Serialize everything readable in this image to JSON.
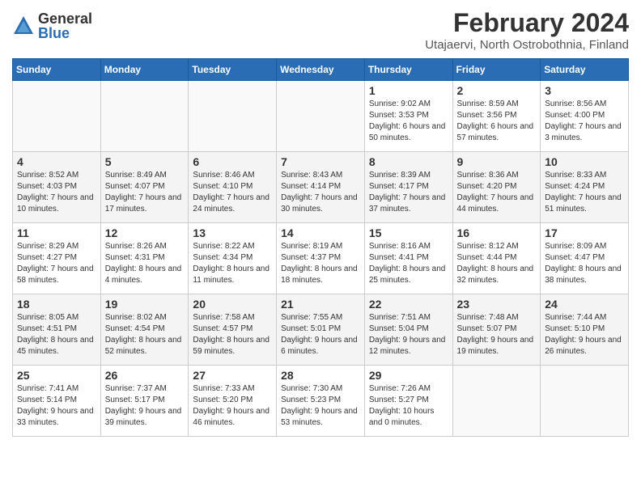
{
  "logo": {
    "general": "General",
    "blue": "Blue"
  },
  "title": "February 2024",
  "subtitle": "Utajaervi, North Ostrobothnia, Finland",
  "days_of_week": [
    "Sunday",
    "Monday",
    "Tuesday",
    "Wednesday",
    "Thursday",
    "Friday",
    "Saturday"
  ],
  "weeks": [
    [
      {
        "day": "",
        "info": ""
      },
      {
        "day": "",
        "info": ""
      },
      {
        "day": "",
        "info": ""
      },
      {
        "day": "",
        "info": ""
      },
      {
        "day": "1",
        "info": "Sunrise: 9:02 AM\nSunset: 3:53 PM\nDaylight: 6 hours\nand 50 minutes."
      },
      {
        "day": "2",
        "info": "Sunrise: 8:59 AM\nSunset: 3:56 PM\nDaylight: 6 hours\nand 57 minutes."
      },
      {
        "day": "3",
        "info": "Sunrise: 8:56 AM\nSunset: 4:00 PM\nDaylight: 7 hours\nand 3 minutes."
      }
    ],
    [
      {
        "day": "4",
        "info": "Sunrise: 8:52 AM\nSunset: 4:03 PM\nDaylight: 7 hours\nand 10 minutes."
      },
      {
        "day": "5",
        "info": "Sunrise: 8:49 AM\nSunset: 4:07 PM\nDaylight: 7 hours\nand 17 minutes."
      },
      {
        "day": "6",
        "info": "Sunrise: 8:46 AM\nSunset: 4:10 PM\nDaylight: 7 hours\nand 24 minutes."
      },
      {
        "day": "7",
        "info": "Sunrise: 8:43 AM\nSunset: 4:14 PM\nDaylight: 7 hours\nand 30 minutes."
      },
      {
        "day": "8",
        "info": "Sunrise: 8:39 AM\nSunset: 4:17 PM\nDaylight: 7 hours\nand 37 minutes."
      },
      {
        "day": "9",
        "info": "Sunrise: 8:36 AM\nSunset: 4:20 PM\nDaylight: 7 hours\nand 44 minutes."
      },
      {
        "day": "10",
        "info": "Sunrise: 8:33 AM\nSunset: 4:24 PM\nDaylight: 7 hours\nand 51 minutes."
      }
    ],
    [
      {
        "day": "11",
        "info": "Sunrise: 8:29 AM\nSunset: 4:27 PM\nDaylight: 7 hours\nand 58 minutes."
      },
      {
        "day": "12",
        "info": "Sunrise: 8:26 AM\nSunset: 4:31 PM\nDaylight: 8 hours\nand 4 minutes."
      },
      {
        "day": "13",
        "info": "Sunrise: 8:22 AM\nSunset: 4:34 PM\nDaylight: 8 hours\nand 11 minutes."
      },
      {
        "day": "14",
        "info": "Sunrise: 8:19 AM\nSunset: 4:37 PM\nDaylight: 8 hours\nand 18 minutes."
      },
      {
        "day": "15",
        "info": "Sunrise: 8:16 AM\nSunset: 4:41 PM\nDaylight: 8 hours\nand 25 minutes."
      },
      {
        "day": "16",
        "info": "Sunrise: 8:12 AM\nSunset: 4:44 PM\nDaylight: 8 hours\nand 32 minutes."
      },
      {
        "day": "17",
        "info": "Sunrise: 8:09 AM\nSunset: 4:47 PM\nDaylight: 8 hours\nand 38 minutes."
      }
    ],
    [
      {
        "day": "18",
        "info": "Sunrise: 8:05 AM\nSunset: 4:51 PM\nDaylight: 8 hours\nand 45 minutes."
      },
      {
        "day": "19",
        "info": "Sunrise: 8:02 AM\nSunset: 4:54 PM\nDaylight: 8 hours\nand 52 minutes."
      },
      {
        "day": "20",
        "info": "Sunrise: 7:58 AM\nSunset: 4:57 PM\nDaylight: 8 hours\nand 59 minutes."
      },
      {
        "day": "21",
        "info": "Sunrise: 7:55 AM\nSunset: 5:01 PM\nDaylight: 9 hours\nand 6 minutes."
      },
      {
        "day": "22",
        "info": "Sunrise: 7:51 AM\nSunset: 5:04 PM\nDaylight: 9 hours\nand 12 minutes."
      },
      {
        "day": "23",
        "info": "Sunrise: 7:48 AM\nSunset: 5:07 PM\nDaylight: 9 hours\nand 19 minutes."
      },
      {
        "day": "24",
        "info": "Sunrise: 7:44 AM\nSunset: 5:10 PM\nDaylight: 9 hours\nand 26 minutes."
      }
    ],
    [
      {
        "day": "25",
        "info": "Sunrise: 7:41 AM\nSunset: 5:14 PM\nDaylight: 9 hours\nand 33 minutes."
      },
      {
        "day": "26",
        "info": "Sunrise: 7:37 AM\nSunset: 5:17 PM\nDaylight: 9 hours\nand 39 minutes."
      },
      {
        "day": "27",
        "info": "Sunrise: 7:33 AM\nSunset: 5:20 PM\nDaylight: 9 hours\nand 46 minutes."
      },
      {
        "day": "28",
        "info": "Sunrise: 7:30 AM\nSunset: 5:23 PM\nDaylight: 9 hours\nand 53 minutes."
      },
      {
        "day": "29",
        "info": "Sunrise: 7:26 AM\nSunset: 5:27 PM\nDaylight: 10 hours\nand 0 minutes."
      },
      {
        "day": "",
        "info": ""
      },
      {
        "day": "",
        "info": ""
      }
    ]
  ]
}
